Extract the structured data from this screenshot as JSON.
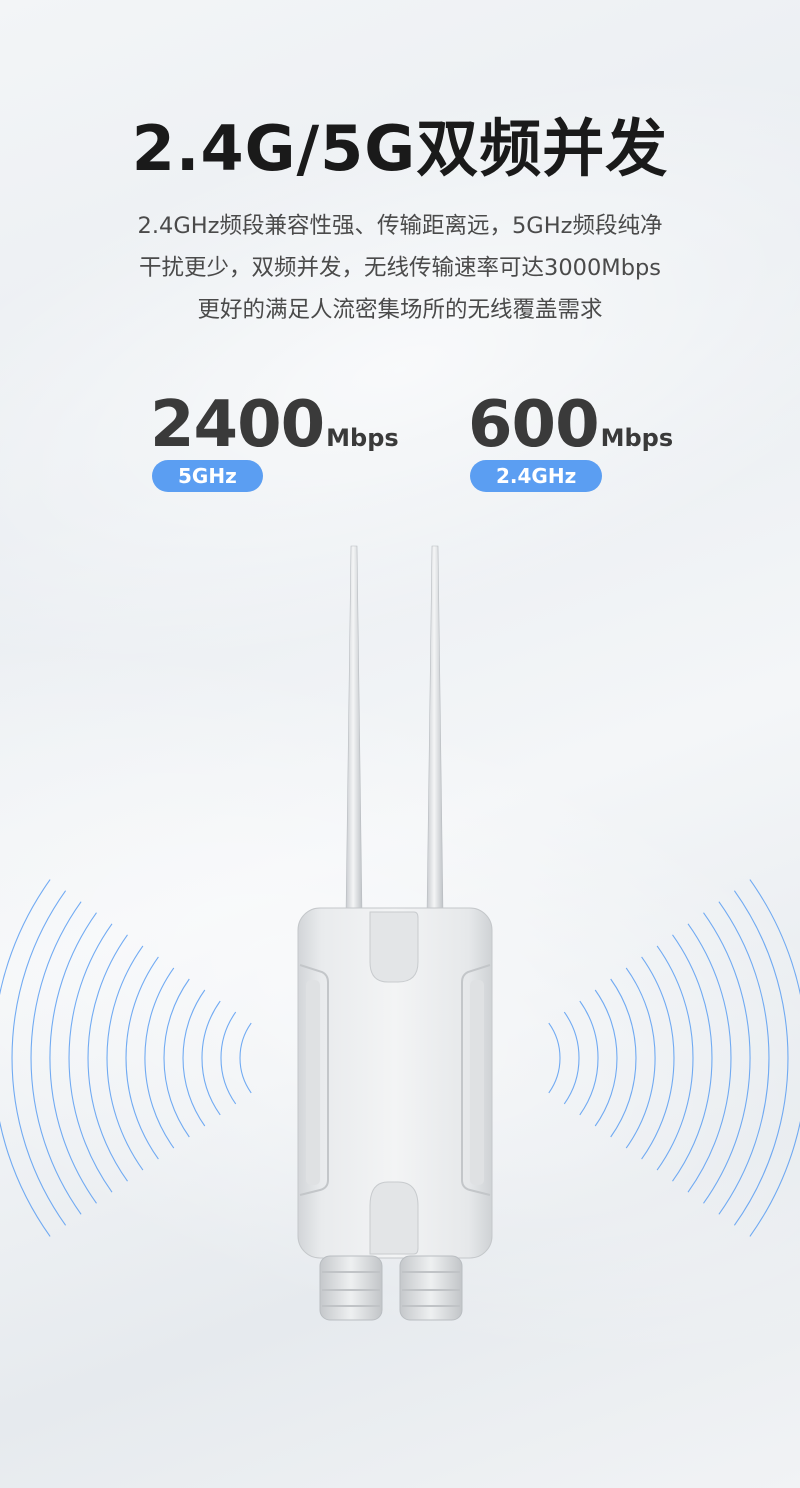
{
  "header": {
    "title": "2.4G/5G双频并发",
    "description_lines": [
      "2.4GHz频段兼容性强、传输距离远，5GHz频段纯净",
      "干扰更少，双频并发，无线传输速率可达3000Mbps",
      "更好的满足人流密集场所的无线覆盖需求"
    ]
  },
  "stats": [
    {
      "value": "2400",
      "unit": "Mbps",
      "band": "5GHz"
    },
    {
      "value": "600",
      "unit": "Mbps",
      "band": "2.4GHz"
    }
  ],
  "colors": {
    "accent": "#5b9ef2",
    "title": "#1a1a1a",
    "text": "#4a4a4a",
    "wave": "#5b9ef2"
  },
  "illustration": {
    "icon": "outdoor-router-with-two-antennas",
    "signal_icon": "signal-waves"
  }
}
